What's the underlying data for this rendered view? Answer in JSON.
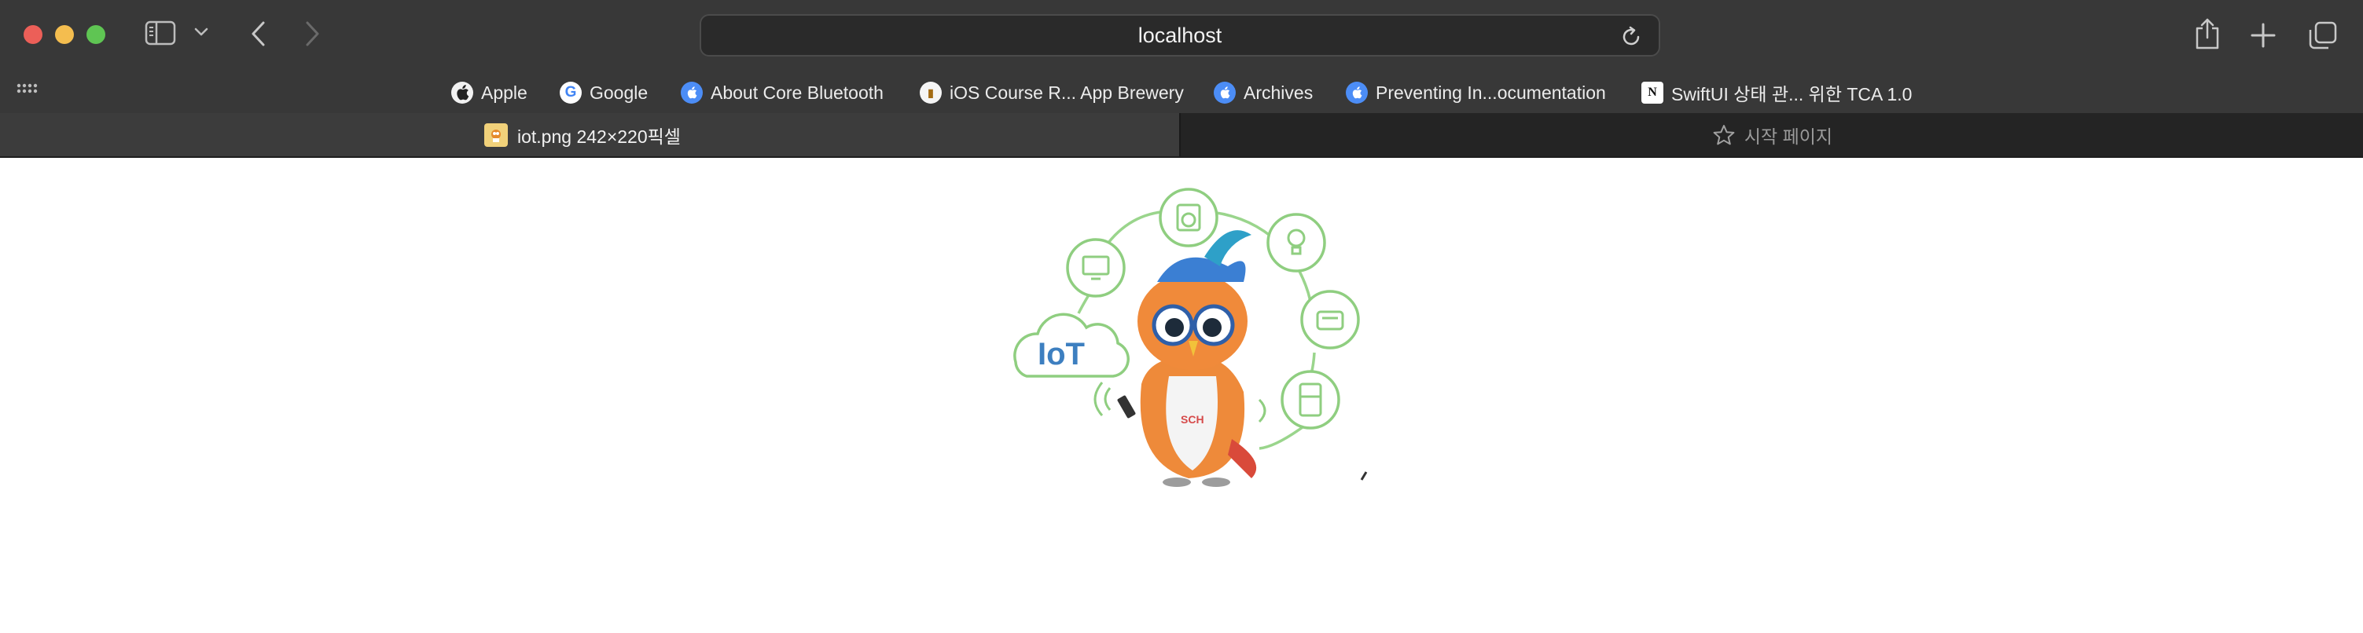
{
  "window": {
    "url": "localhost"
  },
  "favorites": [
    {
      "label": "Apple",
      "icon": "apple-icon"
    },
    {
      "label": "Google",
      "icon": "google-icon"
    },
    {
      "label": "About Core Bluetooth",
      "icon": "apple-docs-icon"
    },
    {
      "label": "iOS Course R... App Brewery",
      "icon": "app-brewery-icon"
    },
    {
      "label": "Archives",
      "icon": "apple-docs-icon"
    },
    {
      "label": "Preventing In...ocumentation",
      "icon": "apple-docs-icon"
    },
    {
      "label": "SwiftUI 상태 관... 위한 TCA 1.0",
      "icon": "notion-icon"
    }
  ],
  "tabs": [
    {
      "label": "iot.png 242×220픽셀",
      "active": true,
      "icon": "image-file-icon"
    },
    {
      "label": "시작 페이지",
      "active": false,
      "icon": "star-icon"
    }
  ],
  "content": {
    "image_text": "IoT",
    "badge_text": "SCH"
  },
  "colors": {
    "chrome": "#383838",
    "accent_green": "#8fce80",
    "iot_blue": "#3d7fc0"
  }
}
